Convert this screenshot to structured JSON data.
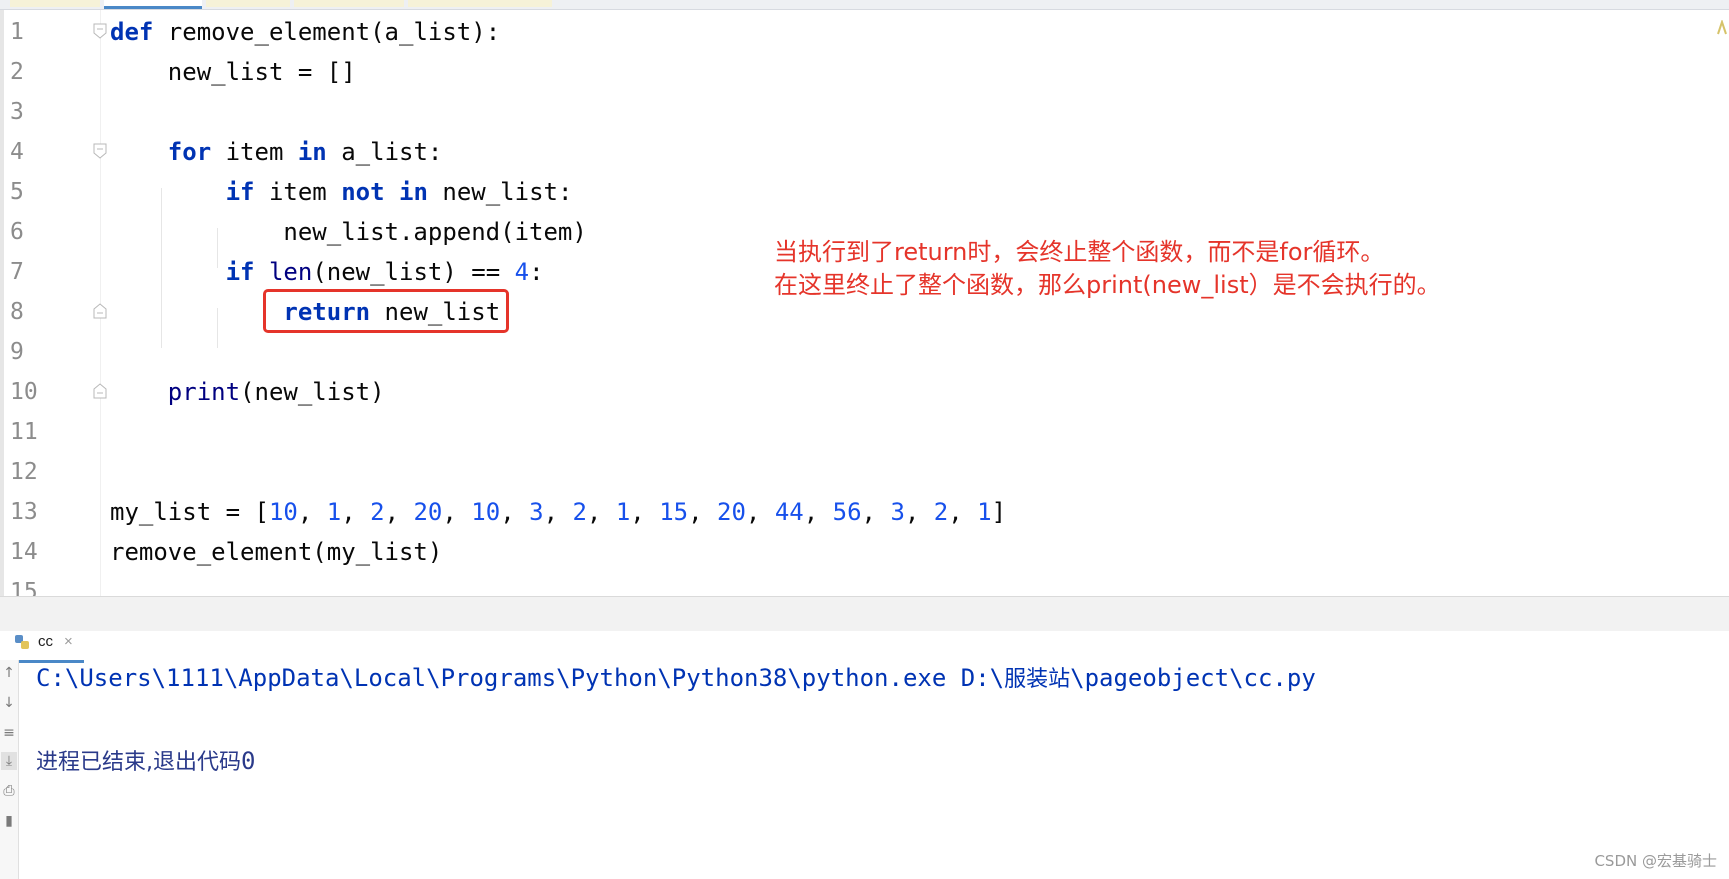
{
  "editor": {
    "lines": [
      {
        "n": "1",
        "tokens": [
          {
            "t": "def",
            "k": "kw"
          },
          {
            "t": " remove_element(a_list):"
          }
        ]
      },
      {
        "n": "2",
        "tokens": [
          {
            "t": "    new_list = []"
          }
        ]
      },
      {
        "n": "3",
        "tokens": []
      },
      {
        "n": "4",
        "tokens": [
          {
            "t": "    "
          },
          {
            "t": "for",
            "k": "kw"
          },
          {
            "t": " item "
          },
          {
            "t": "in",
            "k": "kw"
          },
          {
            "t": " a_list:"
          }
        ]
      },
      {
        "n": "5",
        "tokens": [
          {
            "t": "        "
          },
          {
            "t": "if",
            "k": "kw"
          },
          {
            "t": " item "
          },
          {
            "t": "not",
            "k": "kw"
          },
          {
            "t": " "
          },
          {
            "t": "in",
            "k": "kw"
          },
          {
            "t": " new_list:"
          }
        ]
      },
      {
        "n": "6",
        "tokens": [
          {
            "t": "            new_list.append(item)"
          }
        ]
      },
      {
        "n": "7",
        "tokens": [
          {
            "t": "        "
          },
          {
            "t": "if",
            "k": "kw"
          },
          {
            "t": " "
          },
          {
            "t": "len",
            "k": "bi"
          },
          {
            "t": "(new_list) == "
          },
          {
            "t": "4",
            "k": "num"
          },
          {
            "t": ":"
          }
        ]
      },
      {
        "n": "8",
        "tokens": [
          {
            "t": "            "
          },
          {
            "t": "return",
            "k": "kw"
          },
          {
            "t": " new_list"
          }
        ]
      },
      {
        "n": "9",
        "tokens": []
      },
      {
        "n": "10",
        "tokens": [
          {
            "t": "    "
          },
          {
            "t": "print",
            "k": "bi"
          },
          {
            "t": "(new_list)"
          }
        ]
      },
      {
        "n": "11",
        "tokens": []
      },
      {
        "n": "12",
        "tokens": []
      },
      {
        "n": "13",
        "tokens": [
          {
            "t": "my_list = ["
          },
          {
            "t": "10",
            "k": "num"
          },
          {
            "t": ", "
          },
          {
            "t": "1",
            "k": "num"
          },
          {
            "t": ", "
          },
          {
            "t": "2",
            "k": "num"
          },
          {
            "t": ", "
          },
          {
            "t": "20",
            "k": "num"
          },
          {
            "t": ", "
          },
          {
            "t": "10",
            "k": "num"
          },
          {
            "t": ", "
          },
          {
            "t": "3",
            "k": "num"
          },
          {
            "t": ", "
          },
          {
            "t": "2",
            "k": "num"
          },
          {
            "t": ", "
          },
          {
            "t": "1",
            "k": "num"
          },
          {
            "t": ", "
          },
          {
            "t": "15",
            "k": "num"
          },
          {
            "t": ", "
          },
          {
            "t": "20",
            "k": "num"
          },
          {
            "t": ", "
          },
          {
            "t": "44",
            "k": "num"
          },
          {
            "t": ", "
          },
          {
            "t": "56",
            "k": "num"
          },
          {
            "t": ", "
          },
          {
            "t": "3",
            "k": "num"
          },
          {
            "t": ", "
          },
          {
            "t": "2",
            "k": "num"
          },
          {
            "t": ", "
          },
          {
            "t": "1",
            "k": "num"
          },
          {
            "t": "]"
          }
        ]
      },
      {
        "n": "14",
        "tokens": [
          {
            "t": "remove_element(my_list)"
          }
        ]
      },
      {
        "n": "15",
        "tokens": []
      }
    ]
  },
  "annotation": {
    "line1": "当执行到了return时，会终止整个函数，而不是for循环。",
    "line2": "在这里终止了整个函数，那么print(new_list）是不会执行的。"
  },
  "run": {
    "tab_label": "cc",
    "tab_close": "×",
    "command_prefix": "C:\\Users\\1111\\AppData\\Local\\Programs\\Python\\Python38\\python.exe D:\\",
    "command_cjk": "服装站",
    "command_suffix": "\\pageobject\\cc.py",
    "exit_text": "进程已结束,退出代码",
    "exit_code": "0"
  },
  "watermark": "CSDN @宏基骑士",
  "colors": {
    "keyword": "#0033b3",
    "number": "#1750eb",
    "annotation": "#e5342a",
    "active_tab": "#4a88c7"
  }
}
